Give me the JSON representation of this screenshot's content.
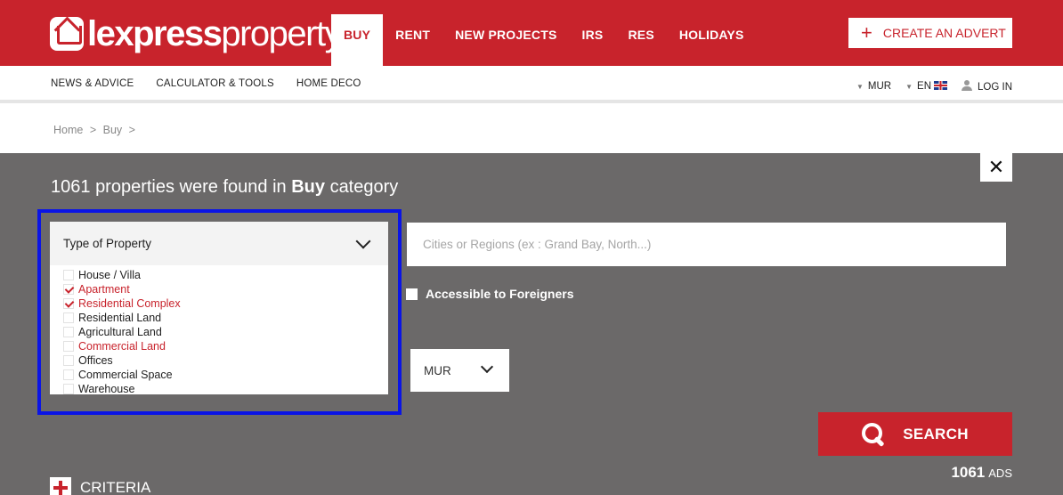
{
  "header": {
    "logo": {
      "bold": "lexpress",
      "light": "property"
    },
    "nav": [
      {
        "label": "BUY",
        "active": true
      },
      {
        "label": "RENT",
        "active": false
      },
      {
        "label": "NEW PROJECTS",
        "active": false
      },
      {
        "label": "IRS",
        "active": false
      },
      {
        "label": "RES",
        "active": false
      },
      {
        "label": "HOLIDAYS",
        "active": false
      }
    ],
    "create_advert": "CREATE AN ADVERT"
  },
  "subnav": {
    "items": [
      "NEWS & ADVICE",
      "CALCULATOR & TOOLS",
      "HOME DECO"
    ],
    "currency": "MUR",
    "language": "EN",
    "login": "LOG IN"
  },
  "breadcrumb": [
    "Home",
    ">",
    "Buy",
    ">"
  ],
  "results": {
    "count": "1061",
    "text_mid": "properties were found in",
    "category": "Buy",
    "text_end": "category"
  },
  "property_type": {
    "label": "Type of Property",
    "options": [
      {
        "label": "House / Villa",
        "selected": false
      },
      {
        "label": "Apartment",
        "selected": true
      },
      {
        "label": "Residential Complex",
        "selected": true
      },
      {
        "label": "Residential Land",
        "selected": false
      },
      {
        "label": "Agricultural Land",
        "selected": false
      },
      {
        "label": "Commercial Land",
        "selected": "highlighted"
      },
      {
        "label": "Offices",
        "selected": false
      },
      {
        "label": "Commercial Space",
        "selected": false
      },
      {
        "label": "Warehouse",
        "selected": false
      }
    ]
  },
  "location": {
    "placeholder": "Cities or Regions (ex : Grand Bay, North...)",
    "value": ""
  },
  "foreigners": {
    "label": "Accessible to Foreigners",
    "checked": false
  },
  "currency_select": {
    "value": "MUR"
  },
  "search": {
    "label": "SEARCH",
    "ads_count": "1061",
    "ads_label": "ADS"
  },
  "criteria": {
    "label": "CRITERIA"
  },
  "colors": {
    "brand_red": "#c8232c",
    "panel_grey": "#6b6969",
    "highlight_blue": "#0a14e6"
  }
}
